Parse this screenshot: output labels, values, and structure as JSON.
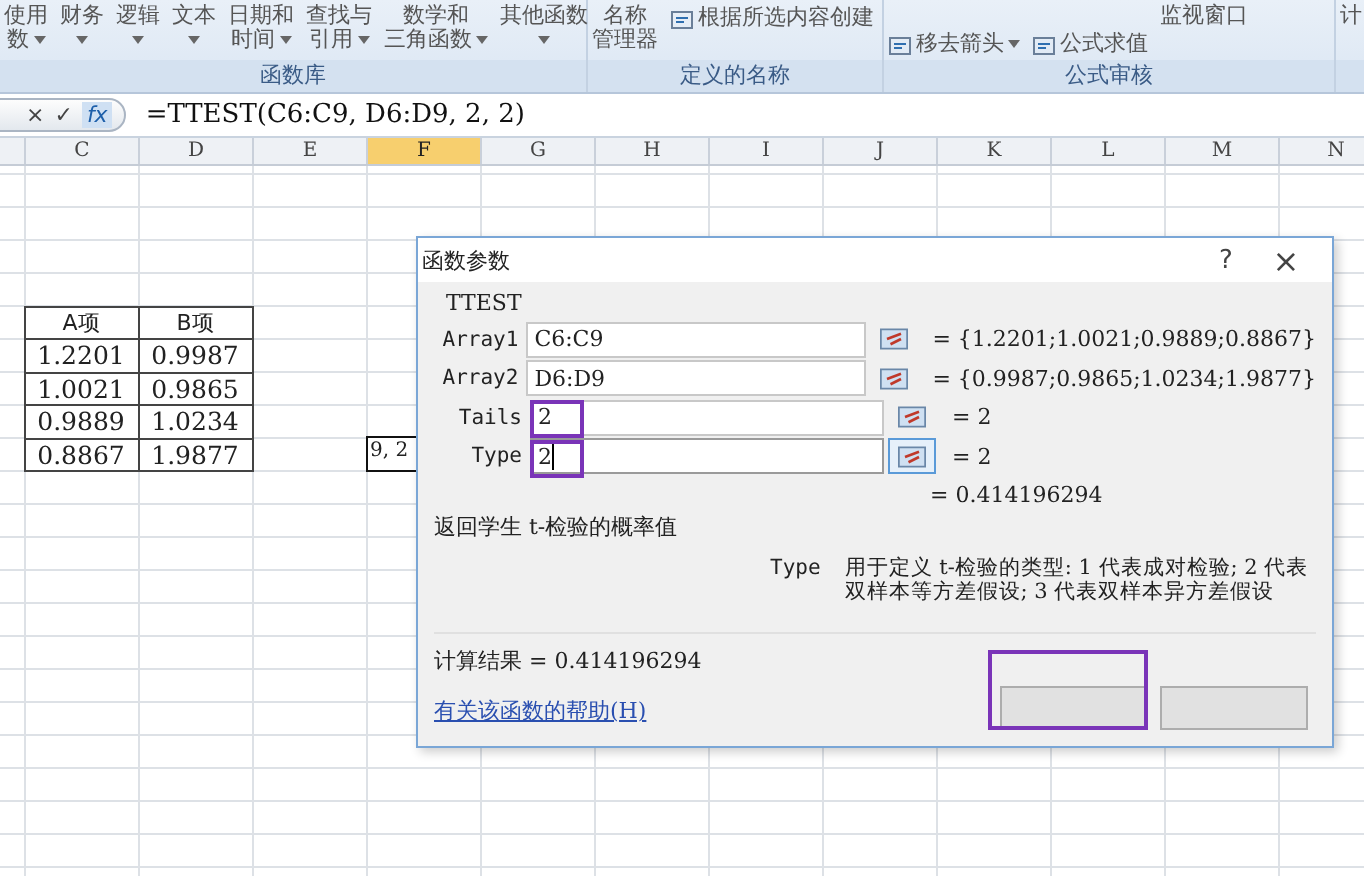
{
  "ribbon": {
    "groups": [
      {
        "label": "函数库",
        "items": [
          {
            "kind": "large",
            "lines": [
              "使用",
              "数"
            ],
            "dropdown": true
          },
          {
            "kind": "large",
            "lines": [
              "财务"
            ],
            "dropdown": true
          },
          {
            "kind": "large",
            "lines": [
              "逻辑"
            ],
            "dropdown": true
          },
          {
            "kind": "large",
            "lines": [
              "文本"
            ],
            "dropdown": true
          },
          {
            "kind": "large",
            "lines": [
              "日期和",
              "时间"
            ],
            "dropdown": true
          },
          {
            "kind": "large",
            "lines": [
              "查找与",
              "引用"
            ],
            "dropdown": true
          },
          {
            "kind": "large",
            "lines": [
              "数学和",
              "三角函数"
            ],
            "dropdown": true
          },
          {
            "kind": "large",
            "lines": [
              "其他函数"
            ],
            "dropdown": true
          }
        ]
      },
      {
        "label": "定义的名称",
        "items": [
          {
            "kind": "large",
            "lines": [
              "名称",
              "管理器"
            ],
            "dropdown": false
          },
          {
            "kind": "small-top",
            "lines": [
              "根据所选内容创建"
            ],
            "dropdown": false
          }
        ]
      },
      {
        "label": "公式审核",
        "items": [
          {
            "kind": "small-bottom",
            "lines": [
              "移去箭头"
            ],
            "dropdown": true
          },
          {
            "kind": "small-bottom",
            "lines": [
              "公式求值"
            ],
            "dropdown": false
          },
          {
            "kind": "large",
            "lines": [
              "监视窗口"
            ],
            "dropdown": false
          }
        ]
      },
      {
        "items": [
          {
            "kind": "large",
            "lines": [
              "计"
            ],
            "dropdown": false
          }
        ]
      }
    ]
  },
  "formula_bar": {
    "buttons": [
      "×",
      "✓",
      "fx"
    ],
    "formula": "=TTEST(C6:C9, D6:D9, 2, 2)"
  },
  "sheet": {
    "columns": [
      {
        "label": "C",
        "selected": false
      },
      {
        "label": "D",
        "selected": false
      },
      {
        "label": "E",
        "selected": false
      },
      {
        "label": "F",
        "selected": true
      },
      {
        "label": "G",
        "selected": false
      },
      {
        "label": "H",
        "selected": false
      },
      {
        "label": "I",
        "selected": false
      },
      {
        "label": "J",
        "selected": false
      },
      {
        "label": "K",
        "selected": false
      },
      {
        "label": "L",
        "selected": false
      },
      {
        "label": "M",
        "selected": false
      },
      {
        "label": "N",
        "selected": false
      }
    ],
    "table": {
      "headers": [
        "A项",
        "B项"
      ],
      "rows": [
        [
          "1.2201",
          "0.9987"
        ],
        [
          "1.0021",
          "0.9865"
        ],
        [
          "0.9889",
          "1.0234"
        ],
        [
          "0.8867",
          "1.9877"
        ]
      ]
    },
    "editing_cell": "9, 2"
  },
  "dialog": {
    "title": "函数参数",
    "help": "?",
    "close": "×",
    "function": "TTEST",
    "arguments": [
      {
        "name": "Array1",
        "value": "C6:C9",
        "result": "= {1.2201;1.0021;0.9889;0.8867}",
        "highlighted": false,
        "focused": false
      },
      {
        "name": "Array2",
        "value": "D6:D9",
        "result": "= {0.9987;0.9865;1.0234;1.9877}",
        "highlighted": false,
        "focused": false
      },
      {
        "name": "Tails",
        "value": "2",
        "result": "= 2",
        "highlighted": true,
        "focused": false
      },
      {
        "name": "Type",
        "value": "2",
        "result": "= 2",
        "highlighted": true,
        "focused": true
      }
    ],
    "formula_result": "= 0.414196294",
    "description": "返回学生 t-检验的概率值",
    "argument_help": {
      "name": "Type",
      "text": "用于定义 t-检验的类型: 1 代表成对检验; 2 代表双样本等方差假设; 3 代表双样本异方差假设"
    },
    "calc_result": "计算结果 = 0.414196294",
    "help_link": "有关该函数的帮助(H)",
    "buttons": [
      {
        "highlighted": true
      },
      {
        "highlighted": false
      }
    ]
  }
}
